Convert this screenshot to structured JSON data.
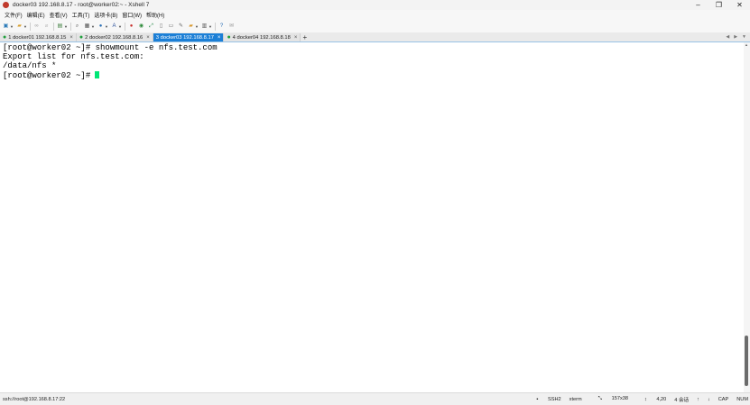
{
  "window": {
    "title": "docker03 192.168.8.17 - root@worker02:~ - Xshell 7",
    "minimize": "–",
    "maximize": "❐",
    "close": "✕"
  },
  "menu": [
    "文件(F)",
    "编辑(E)",
    "查看(V)",
    "工具(T)",
    "选项卡(B)",
    "窗口(W)",
    "帮助(H)"
  ],
  "tabs": [
    {
      "label": "1 docker01 192.168.8.15",
      "active": false
    },
    {
      "label": "2 docker02 192.168.8.16",
      "active": false
    },
    {
      "label": "3 docker03 192.168.8.17",
      "active": true
    },
    {
      "label": "4 docker04 192.168.8.18",
      "active": false
    }
  ],
  "tab_close": "×",
  "tab_add": "+",
  "terminal": {
    "lines": [
      "[root@worker02 ~]# showmount -e nfs.test.com",
      "Export list for nfs.test.com:",
      "/data/nfs *"
    ],
    "prompt": "[root@worker02 ~]#"
  },
  "status": {
    "connection": "ssh://root@192.168.8.17:22",
    "protocol": "SSH2",
    "term": "xterm",
    "size": "157x38",
    "cursor_pos": "4,20",
    "sessions": "4 会话",
    "caps": "CAP",
    "num": "NUM"
  },
  "colors": {
    "active_tab": "#1c7fd6",
    "cursor": "#00e676",
    "tab_dot": "#1e9e3a"
  }
}
